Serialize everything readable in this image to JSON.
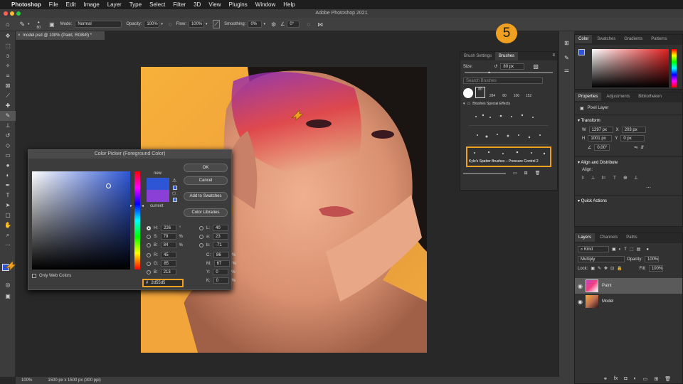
{
  "menubar": {
    "app": "Photoshop",
    "items": [
      "File",
      "Edit",
      "Image",
      "Layer",
      "Type",
      "Select",
      "Filter",
      "3D",
      "View",
      "Plugins",
      "Window",
      "Help"
    ]
  },
  "window_title": "Adobe Photoshop 2021",
  "options": {
    "brush_size": "80",
    "mode_label": "Mode:",
    "mode_value": "Normal",
    "opacity_label": "Opacity:",
    "opacity_value": "100%",
    "flow_label": "Flow:",
    "flow_value": "100%",
    "smoothing_label": "Smoothing:",
    "smoothing_value": "0%",
    "angle_value": "0°"
  },
  "document": {
    "tab": "model.psd @ 100% (Paint, RGB/8) *",
    "status_zoom": "100%",
    "status_info": "1500 px x 1500 px (300 ppi)"
  },
  "step_badge": "5",
  "brushes_panel": {
    "tabs": [
      "Brush Settings",
      "Brushes"
    ],
    "size_label": "Size:",
    "size_value": "80 px",
    "search_placeholder": "Search Brushes",
    "presets": [
      "80",
      "284",
      "80",
      "100",
      "152"
    ],
    "group_name": "Brushes Special Effects",
    "selected_brush": "Kyle's Spatter Brushes – Pressure Control 2"
  },
  "color_panel": {
    "tabs": [
      "Color",
      "Swatches",
      "Gradients",
      "Patterns"
    ]
  },
  "properties_panel": {
    "tabs": [
      "Properties",
      "Adjustments",
      "Bibliotheken"
    ],
    "layer_type": "Pixel Layer",
    "transform_label": "Transform",
    "w_label": "W",
    "w_value": "1297 px",
    "x_label": "X",
    "x_value": "203 px",
    "h_label": "H",
    "h_value": "1001 px",
    "y_label": "Y",
    "y_value": "0 px",
    "angle_value": "0,00°",
    "align_label": "Align and Distribute",
    "align_sub": "Align:",
    "quick_label": "Quick Actions"
  },
  "layers_panel": {
    "tabs": [
      "Layers",
      "Channels",
      "Paths"
    ],
    "kind_label": "Kind",
    "blend_mode": "Multiply",
    "opacity_label": "Opacity:",
    "opacity_value": "100%",
    "lock_label": "Lock:",
    "fill_label": "Fill:",
    "fill_value": "100%",
    "layers": [
      {
        "name": "Paint"
      },
      {
        "name": "Model"
      }
    ]
  },
  "color_picker": {
    "title": "Color Picker (Foreground Color)",
    "buttons": [
      "OK",
      "Cancel",
      "Add to Swatches",
      "Color Libraries"
    ],
    "new_label": "new",
    "current_label": "current",
    "new_color": "#2d55d5",
    "current_color": "#8a3fd6",
    "only_web": "Only Web Colors",
    "hex_prefix": "#",
    "hex_value": "2d55d5",
    "fields": {
      "H": "226",
      "S": "79",
      "B": "84",
      "R": "45",
      "G": "85",
      "Bv": "213",
      "L": "40",
      "a": "23",
      "b": "-71",
      "C": "86",
      "M": "67",
      "Y": "0",
      "K": "0"
    },
    "units": {
      "deg": "°",
      "pct": "%"
    }
  },
  "colors": {
    "accent_orange": "#f0a020",
    "fg_swatch": "#2d55d5"
  }
}
